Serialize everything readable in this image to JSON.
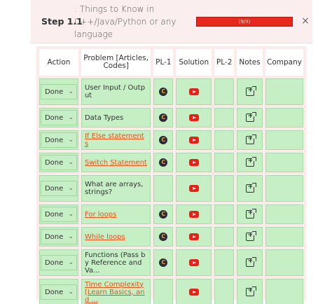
{
  "step": {
    "label": "Step 1.1",
    "title": ": Things to Know in C++/Java/Python or any language",
    "progress_text": "(9/9)",
    "progress_fraction": 1.0,
    "close_label": "×"
  },
  "table": {
    "headers": {
      "action": "Action",
      "problem": "Problem [Articles, Codes]",
      "pl1": "PL-1",
      "solution": "Solution",
      "pl2": "PL-2",
      "notes": "Notes",
      "company": "Company"
    },
    "rows": [
      {
        "status": "Done",
        "problem": "User Input / Output",
        "link": false,
        "has_pl1": true
      },
      {
        "status": "Done",
        "problem": "Data Types",
        "link": false,
        "has_pl1": true
      },
      {
        "status": "Done",
        "problem": "If Else statements",
        "link": true,
        "has_pl1": true
      },
      {
        "status": "Done",
        "problem": "Switch Statement",
        "link": true,
        "has_pl1": true
      },
      {
        "status": "Done",
        "problem": "What are arrays, strings?",
        "link": false,
        "has_pl1": false
      },
      {
        "status": "Done",
        "problem": "For loops",
        "link": true,
        "has_pl1": true
      },
      {
        "status": "Done",
        "problem": "While loops",
        "link": true,
        "has_pl1": true
      },
      {
        "status": "Done",
        "problem": "Functions (Pass by Reference and Va...",
        "link": false,
        "has_pl1": true
      },
      {
        "status": "Done",
        "problem": "Time Complexity [Learn Basics, and ...",
        "link": true,
        "has_pl1": false
      }
    ]
  },
  "icons": {
    "pl1": "leetcode-icon",
    "solution": "youtube-icon",
    "notes": "add-note-icon",
    "dropdown": "chevron-down-icon"
  },
  "colors": {
    "header_bg": "#fbeeee",
    "row_bg": "#c7efc6",
    "progress": "#e8281e",
    "link": "#e2551b"
  }
}
